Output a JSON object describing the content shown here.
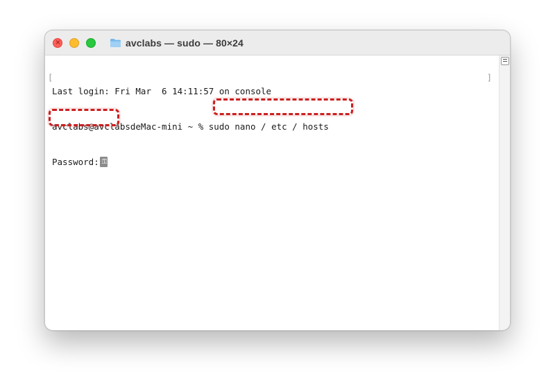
{
  "window": {
    "title": "avclabs — sudo — 80×24",
    "folder_icon": "folder-icon"
  },
  "traffic_lights": {
    "close": "close-button",
    "minimize": "minimize-button",
    "zoom": "zoom-button",
    "close_glyph": "×"
  },
  "terminal": {
    "lines": [
      "Last login: Fri Mar  6 14:11:57 on console",
      "avclabs@avclabsdeMac-mini ~ % sudo nano / etc / hosts",
      "Password:"
    ],
    "cursor_glyph": "⚿",
    "left_bracket": "[",
    "right_bracket": "]"
  },
  "highlights": [
    {
      "label": "command-highlight",
      "target": "sudo nano / etc / hosts"
    },
    {
      "label": "password-highlight",
      "target": "Password:"
    }
  ],
  "colors": {
    "highlight": "#cc1f1f",
    "close": "#fe5f57",
    "minimize": "#febc2e",
    "zoom": "#28c840",
    "titlebar": "#ececec"
  }
}
